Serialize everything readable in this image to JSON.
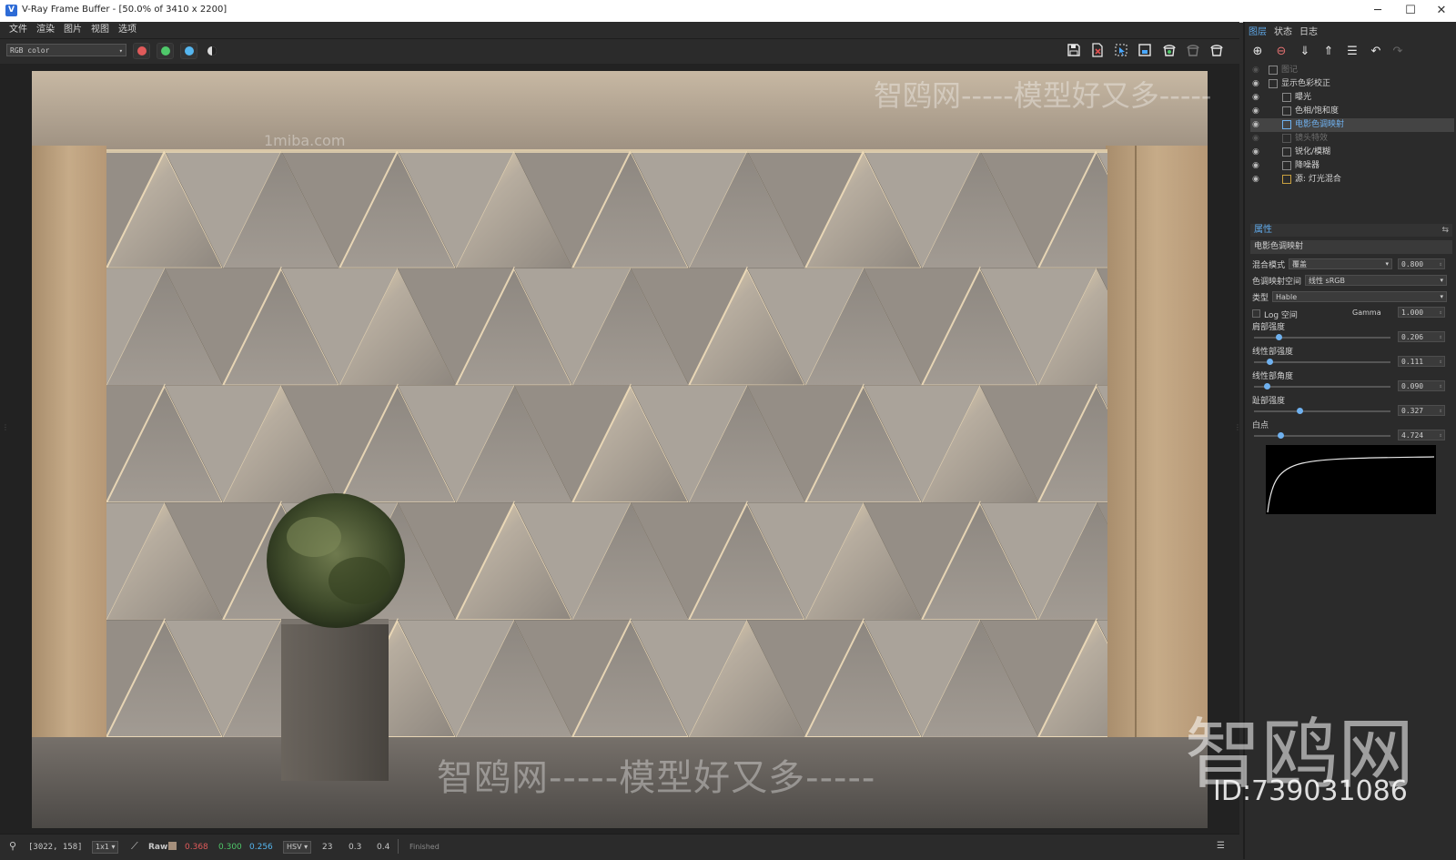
{
  "window": {
    "title": "V-Ray Frame Buffer - [50.0% of 3410 x 2200]",
    "app_icon": "vray-icon",
    "controls": {
      "minimize": "─",
      "maximize": "☐",
      "close": "✕"
    }
  },
  "menu": [
    "文件",
    "渲染",
    "图片",
    "视图",
    "选项"
  ],
  "toolbar": {
    "channel": "RGB color",
    "channel_buttons": [
      {
        "name": "red-channel",
        "color": "#e05a5a"
      },
      {
        "name": "green-channel",
        "color": "#4fc86a"
      },
      {
        "name": "blue-channel",
        "color": "#55b6ef"
      }
    ],
    "tools": [
      "save-icon",
      "clear-icon",
      "region-render-icon",
      "track-mouse-icon",
      "render-icon",
      "interactive-render-icon",
      "stop-render-icon"
    ]
  },
  "status": {
    "coords": "[3022, 158]",
    "zoom": "1x1",
    "mode": "Raw",
    "r": "0.368",
    "g": "0.300",
    "b": "0.256",
    "colorspace": "HSV",
    "h": "23",
    "s": "0.3",
    "v": "0.4",
    "state": "Finished"
  },
  "right_panel": {
    "tabs": [
      "图层",
      "状态",
      "日志"
    ],
    "layers": [
      {
        "label": "图记",
        "visible": false,
        "dim": true,
        "indent": 0
      },
      {
        "label": "显示色彩校正",
        "visible": true,
        "dim": false,
        "indent": 0
      },
      {
        "label": "曝光",
        "visible": true,
        "dim": false,
        "indent": 1
      },
      {
        "label": "色相/饱和度",
        "visible": true,
        "dim": false,
        "indent": 1
      },
      {
        "label": "电影色调映射",
        "visible": true,
        "dim": false,
        "indent": 1,
        "selected": true
      },
      {
        "label": "镜头特效",
        "visible": false,
        "dim": true,
        "indent": 1
      },
      {
        "label": "锐化/模糊",
        "visible": true,
        "dim": false,
        "indent": 1
      },
      {
        "label": "降噪器",
        "visible": true,
        "dim": false,
        "indent": 1
      },
      {
        "label": "源: 灯光混合",
        "visible": true,
        "dim": false,
        "indent": 1
      }
    ],
    "properties": {
      "header": "属性",
      "title": "电影色调映射",
      "blend_label": "混合模式",
      "blend_value": "覆盖",
      "blend_amount": "0.800",
      "space_label": "色调映射空间",
      "space_value": "线性 sRGB",
      "type_label": "类型",
      "type_value": "Hable",
      "log_label": "Log 空间",
      "gamma_label": "Gamma",
      "gamma_value": "1.000",
      "sliders": [
        {
          "label": "肩部强度",
          "value": "0.206",
          "fraction": 0.18
        },
        {
          "label": "线性部强度",
          "value": "0.111",
          "fraction": 0.11
        },
        {
          "label": "线性部角度",
          "value": "0.090",
          "fraction": 0.09
        },
        {
          "label": "趾部强度",
          "value": "0.327",
          "fraction": 0.33
        },
        {
          "label": "白点",
          "value": "4.724",
          "fraction": 0.19
        }
      ]
    }
  },
  "watermarks": {
    "main": "智鸥网-----模型好又多-----",
    "site": "1miba.com",
    "logo": "智鸥网",
    "id": "ID:739031086"
  }
}
